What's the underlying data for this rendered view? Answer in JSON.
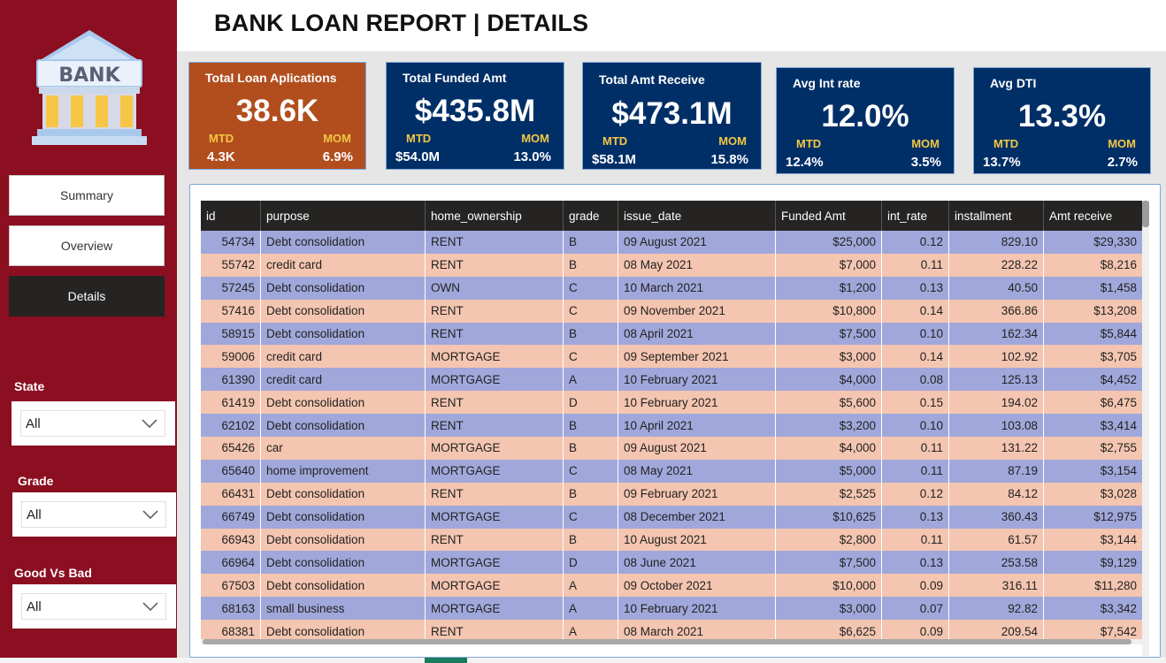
{
  "title": "BANK LOAN REPORT | DETAILS",
  "logo_text": "BANK",
  "nav": {
    "summary": "Summary",
    "overview": "Overview",
    "details": "Details"
  },
  "filters": [
    {
      "label": "State",
      "value": "All"
    },
    {
      "label": "Grade",
      "value": "All"
    },
    {
      "label": "Good Vs Bad",
      "value": "All"
    }
  ],
  "kpis": [
    {
      "label": "Total Loan Aplications",
      "value": "38.6K",
      "mtd_label": "MTD",
      "mtd": "4.3K",
      "mom_label": "MOM",
      "mom": "6.9%"
    },
    {
      "label": "Total Funded Amt",
      "value": "$435.8M",
      "mtd_label": "MTD",
      "mtd": "$54.0M",
      "mom_label": "MOM",
      "mom": "13.0%"
    },
    {
      "label": "Total  Amt Receive",
      "value": "$473.1M",
      "mtd_label": "MTD",
      "mtd": "$58.1M",
      "mom_label": "MOM",
      "mom": "15.8%"
    },
    {
      "label": "Avg Int rate",
      "value": "12.0%",
      "mtd_label": "MTD",
      "mtd": "12.4%",
      "mom_label": "MOM",
      "mom": "3.5%"
    },
    {
      "label": "Avg DTI",
      "value": "13.3%",
      "mtd_label": "MTD",
      "mtd": "13.7%",
      "mom_label": "MOM",
      "mom": "2.7%"
    }
  ],
  "table": {
    "columns": [
      "id",
      "purpose",
      "home_ownership",
      "grade",
      "issue_date",
      "Funded Amt",
      "int_rate",
      "installment",
      "Amt receive"
    ],
    "rows": [
      [
        "54734",
        "Debt consolidation",
        "RENT",
        "B",
        "09 August 2021",
        "$25,000",
        "0.12",
        "829.10",
        "$29,330"
      ],
      [
        "55742",
        "credit card",
        "RENT",
        "B",
        "08 May 2021",
        "$7,000",
        "0.11",
        "228.22",
        "$8,216"
      ],
      [
        "57245",
        "Debt consolidation",
        "OWN",
        "C",
        "10 March 2021",
        "$1,200",
        "0.13",
        "40.50",
        "$1,458"
      ],
      [
        "57416",
        "Debt consolidation",
        "RENT",
        "C",
        "09 November 2021",
        "$10,800",
        "0.14",
        "366.86",
        "$13,208"
      ],
      [
        "58915",
        "Debt consolidation",
        "RENT",
        "B",
        "08 April 2021",
        "$7,500",
        "0.10",
        "162.34",
        "$5,844"
      ],
      [
        "59006",
        "credit card",
        "MORTGAGE",
        "C",
        "09 September 2021",
        "$3,000",
        "0.14",
        "102.92",
        "$3,705"
      ],
      [
        "61390",
        "credit card",
        "MORTGAGE",
        "A",
        "10 February 2021",
        "$4,000",
        "0.08",
        "125.13",
        "$4,452"
      ],
      [
        "61419",
        "Debt consolidation",
        "RENT",
        "D",
        "10 February 2021",
        "$5,600",
        "0.15",
        "194.02",
        "$6,475"
      ],
      [
        "62102",
        "Debt consolidation",
        "RENT",
        "B",
        "10 April 2021",
        "$3,200",
        "0.10",
        "103.08",
        "$3,414"
      ],
      [
        "65426",
        "car",
        "MORTGAGE",
        "B",
        "09 August 2021",
        "$4,000",
        "0.11",
        "131.22",
        "$2,755"
      ],
      [
        "65640",
        "home improvement",
        "MORTGAGE",
        "C",
        "08 May 2021",
        "$5,000",
        "0.11",
        "87.19",
        "$3,154"
      ],
      [
        "66431",
        "Debt consolidation",
        "RENT",
        "B",
        "09 February 2021",
        "$2,525",
        "0.12",
        "84.12",
        "$3,028"
      ],
      [
        "66749",
        "Debt consolidation",
        "MORTGAGE",
        "C",
        "08 December 2021",
        "$10,625",
        "0.13",
        "360.43",
        "$12,975"
      ],
      [
        "66943",
        "Debt consolidation",
        "RENT",
        "B",
        "10 August 2021",
        "$2,800",
        "0.11",
        "61.57",
        "$3,144"
      ],
      [
        "66964",
        "Debt consolidation",
        "MORTGAGE",
        "D",
        "08 June 2021",
        "$7,500",
        "0.13",
        "253.58",
        "$9,129"
      ],
      [
        "67503",
        "Debt consolidation",
        "MORTGAGE",
        "A",
        "09 October 2021",
        "$10,000",
        "0.09",
        "316.11",
        "$11,280"
      ],
      [
        "68163",
        "small business",
        "MORTGAGE",
        "A",
        "10 February 2021",
        "$3,000",
        "0.07",
        "92.82",
        "$3,342"
      ],
      [
        "68381",
        "Debt consolidation",
        "RENT",
        "A",
        "08 March 2021",
        "$6,625",
        "0.09",
        "209.54",
        "$7,542"
      ]
    ]
  },
  "colors": {
    "sidebar": "#8b0e21",
    "kpi_blue": "#002f67",
    "kpi_orange": "#b24e1e",
    "row_odd": "#a0a8db",
    "row_even": "#f4c5b0",
    "header_dark": "#252423",
    "accent_yellow": "#f2c744"
  }
}
